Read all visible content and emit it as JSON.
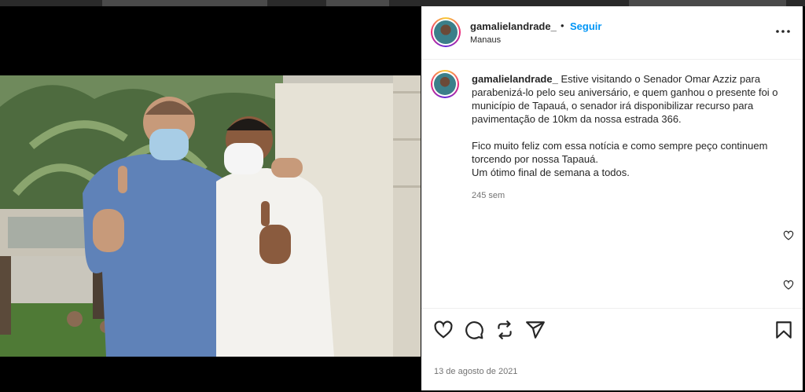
{
  "post": {
    "username": "gamalielandrade_",
    "separator": "•",
    "follow_label": "Seguir",
    "location": "Manaus",
    "more_icon": "more-horizontal-icon",
    "caption": {
      "username": "gamalielandrade_",
      "text": " Estive visitando o Senador Omar Azziz para parabenizá-lo pelo seu aniversário, e quem ganhou o presente foi o município de Tapauá, o senador irá disponibilizar recurso para pavimentação de 10km da nossa estrada 366.\n\nFico muito feliz com essa notícia e como sempre peço continuem torcendo por nossa Tapauá.\nUm ótimo final de semana a todos.",
      "time_ago": "245 sem"
    },
    "date": "13 de agosto de 2021",
    "actions": [
      "heart-icon",
      "comment-icon",
      "share-icon",
      "send-icon",
      "bookmark-icon"
    ]
  },
  "colors": {
    "link": "#0095f6",
    "text": "#262626",
    "muted": "#737373"
  }
}
